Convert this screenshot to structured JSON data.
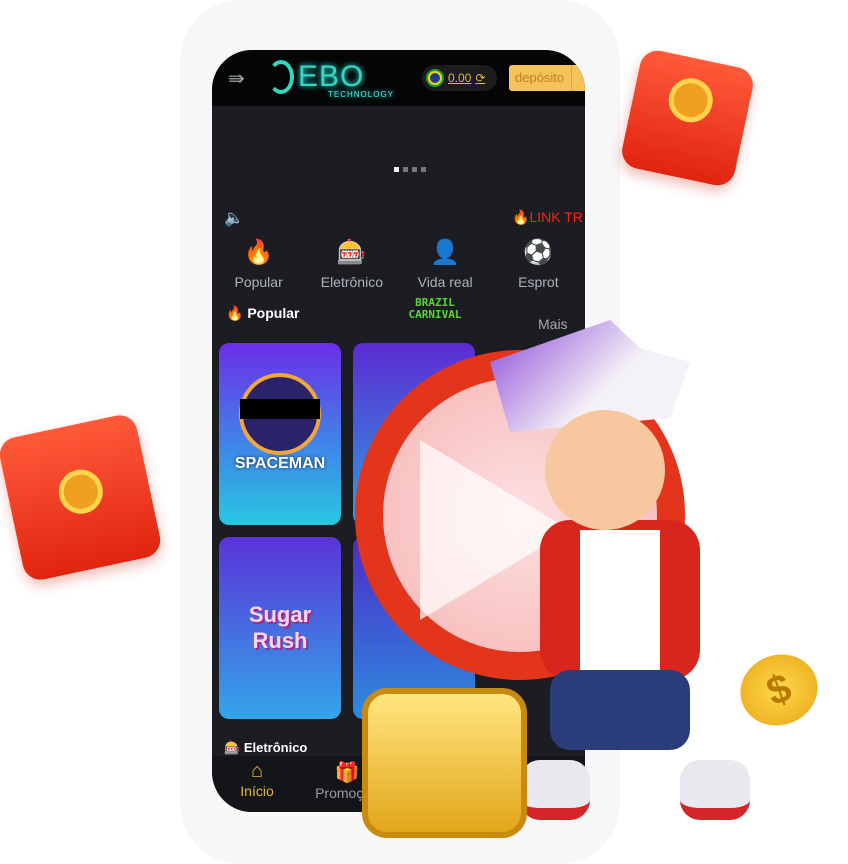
{
  "header": {
    "logo": "EBO",
    "logo_sub": "TECHNOLOGY",
    "balance": "0.00",
    "deposit_label": "depósito"
  },
  "marquee": "LINK TR",
  "categories": [
    {
      "label": "Popular"
    },
    {
      "label": "Eletrônico"
    },
    {
      "label": "Vida real"
    },
    {
      "label": "Esprot"
    }
  ],
  "section": {
    "title": "Popular",
    "banner": "BRAZIL CARNIVAL",
    "more": "Mais",
    "next_title": "Eletrônico"
  },
  "games": [
    {
      "name": "SPACEMAN"
    },
    {
      "name": ""
    },
    {
      "name": "Sugar Rush"
    },
    {
      "name": ""
    }
  ],
  "nav": [
    {
      "label": "Início"
    },
    {
      "label": "Promoção"
    }
  ],
  "colors": {
    "accent": "#e4b73a",
    "bg": "#1c1d22",
    "envelope": "#e0240f"
  }
}
